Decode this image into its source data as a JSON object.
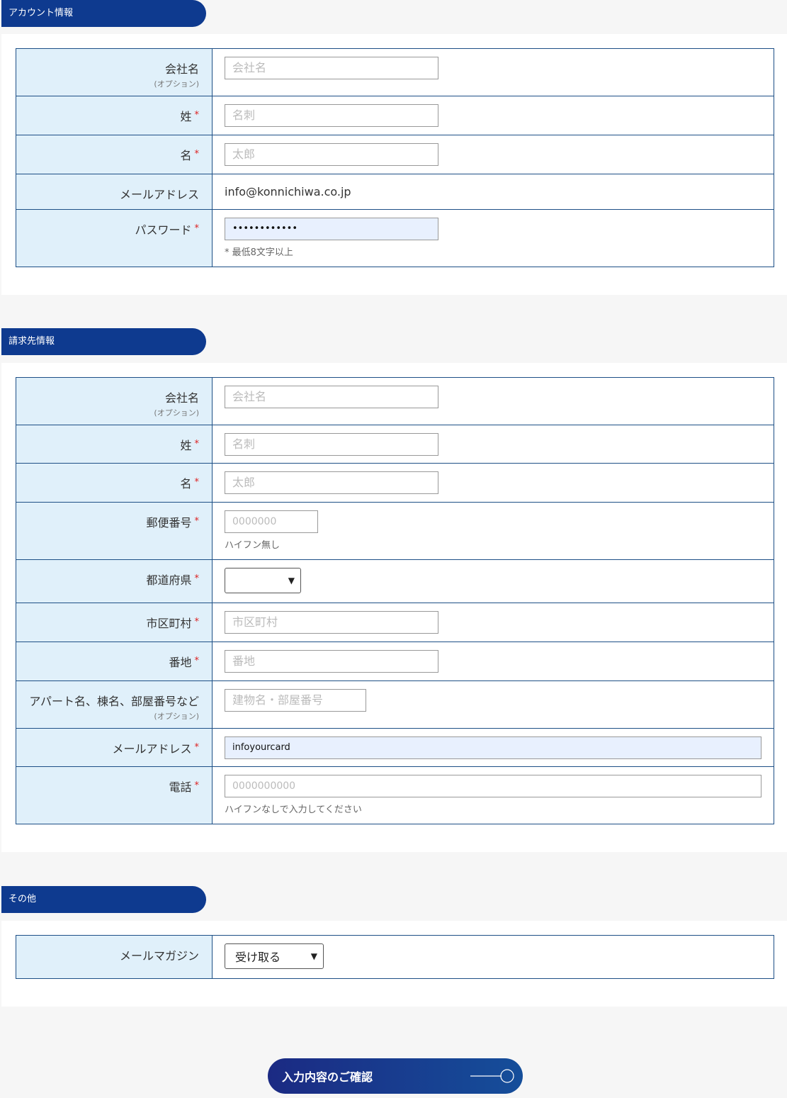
{
  "sections": {
    "account": "アカウント情報",
    "billing": "請求先情報",
    "other": "その他"
  },
  "req_mark": "*",
  "optional": "(オプション)",
  "account": {
    "company_label": "会社名",
    "company_placeholder": "会社名",
    "lastname_label": "姓",
    "lastname_placeholder": "名刺",
    "firstname_label": "名",
    "firstname_placeholder": "太郎",
    "email_label": "メールアドレス",
    "email_value": "info@konnichiwa.co.jp",
    "password_label": "パスワード",
    "password_value": "••••••••••••",
    "password_hint": "* 最低8文字以上"
  },
  "billing": {
    "company_label": "会社名",
    "company_placeholder": "会社名",
    "lastname_label": "姓",
    "lastname_placeholder": "名刺",
    "firstname_label": "名",
    "firstname_placeholder": "太郎",
    "zip_label": "郵便番号",
    "zip_placeholder": "0000000",
    "zip_hint": "ハイフン無し",
    "pref_label": "都道府県",
    "pref_value": "",
    "city_label": "市区町村",
    "city_placeholder": "市区町村",
    "street_label": "番地",
    "street_placeholder": "番地",
    "building_label": "アパート名、棟名、部屋番号など",
    "building_placeholder": "建物名・部屋番号",
    "email_label": "メールアドレス",
    "email_value": "infoyourcard",
    "phone_label": "電話",
    "phone_placeholder": "0000000000",
    "phone_hint": "ハイフンなしで入力してください"
  },
  "other": {
    "mag_label": "メールマガジン",
    "mag_value": "受け取る"
  },
  "confirm_label": "入力内容のご確認"
}
